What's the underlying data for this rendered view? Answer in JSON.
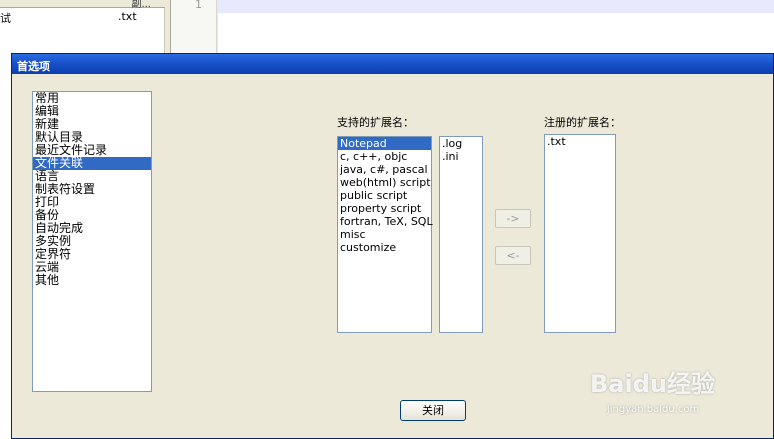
{
  "background": {
    "left_header_label": "副...",
    "left_row_col1": "试",
    "left_row_col2": ".txt",
    "gutter_line_number": "1"
  },
  "dialog": {
    "title": "首选项",
    "categories": [
      {
        "label": "常用",
        "selected": false
      },
      {
        "label": "编辑",
        "selected": false
      },
      {
        "label": "新建",
        "selected": false
      },
      {
        "label": "默认目录",
        "selected": false
      },
      {
        "label": "最近文件记录",
        "selected": false
      },
      {
        "label": "文件关联",
        "selected": true
      },
      {
        "label": "语言",
        "selected": false
      },
      {
        "label": "制表符设置",
        "selected": false
      },
      {
        "label": "打印",
        "selected": false
      },
      {
        "label": "备份",
        "selected": false
      },
      {
        "label": "自动完成",
        "selected": false
      },
      {
        "label": "多实例",
        "selected": false
      },
      {
        "label": "定界符",
        "selected": false
      },
      {
        "label": "云端",
        "selected": false
      },
      {
        "label": "其他",
        "selected": false
      }
    ],
    "supported_label": "支持的扩展名：",
    "registered_label": "注册的扩展名：",
    "supported_types": [
      {
        "label": "Notepad",
        "selected": true
      },
      {
        "label": "c, c++, objc",
        "selected": false
      },
      {
        "label": "java, c#, pascal",
        "selected": false
      },
      {
        "label": "web(html) script",
        "selected": false
      },
      {
        "label": "public script",
        "selected": false
      },
      {
        "label": "property script",
        "selected": false
      },
      {
        "label": "fortran, TeX, SQL",
        "selected": false
      },
      {
        "label": "misc",
        "selected": false
      },
      {
        "label": "customize",
        "selected": false
      }
    ],
    "supported_extensions": [
      ".log",
      ".ini"
    ],
    "registered_extensions": [
      ".txt"
    ],
    "add_button": "->",
    "remove_button": "<-",
    "close_button": "关闭"
  },
  "watermark": {
    "brand": "Baidu经验",
    "url": "jingyan.baidu.com"
  },
  "colors": {
    "titlebar": "#0d3fae",
    "selection": "#316ac5",
    "dialog_bg": "#ece9d8"
  }
}
